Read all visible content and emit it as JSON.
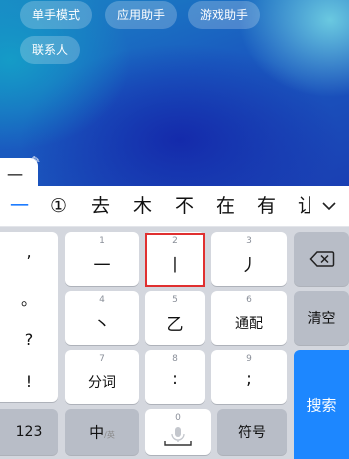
{
  "shortcuts": [
    "单手模式",
    "应用助手",
    "游戏助手",
    "联系人"
  ],
  "composing_text": "一",
  "candidates": [
    "一",
    "①",
    "去",
    "木",
    "不",
    "在",
    "有",
    "让"
  ],
  "punctuation": [
    ",",
    "。",
    "?",
    "!"
  ],
  "stroke_keys": [
    {
      "num": "1",
      "label": "一"
    },
    {
      "num": "2",
      "label": "丨"
    },
    {
      "num": "3",
      "label": "丿"
    },
    {
      "num": "4",
      "label": "丶"
    },
    {
      "num": "5",
      "label": "乙"
    },
    {
      "num": "6",
      "label": "通配"
    },
    {
      "num": "7",
      "label": "分词"
    },
    {
      "num": "8",
      "label": ":"
    },
    {
      "num": "9",
      "label": ";"
    },
    {
      "num": "0",
      "label": ""
    }
  ],
  "keys": {
    "delete_icon": "backspace-icon",
    "clear": "清空",
    "search": "搜索",
    "num_mode": "123",
    "lang_main": "中",
    "lang_alt": "/英",
    "symbols": "符号",
    "space_icon": "microphone-icon"
  },
  "colors": {
    "accent": "#1d87ff",
    "highlight_border": "#e03030"
  }
}
